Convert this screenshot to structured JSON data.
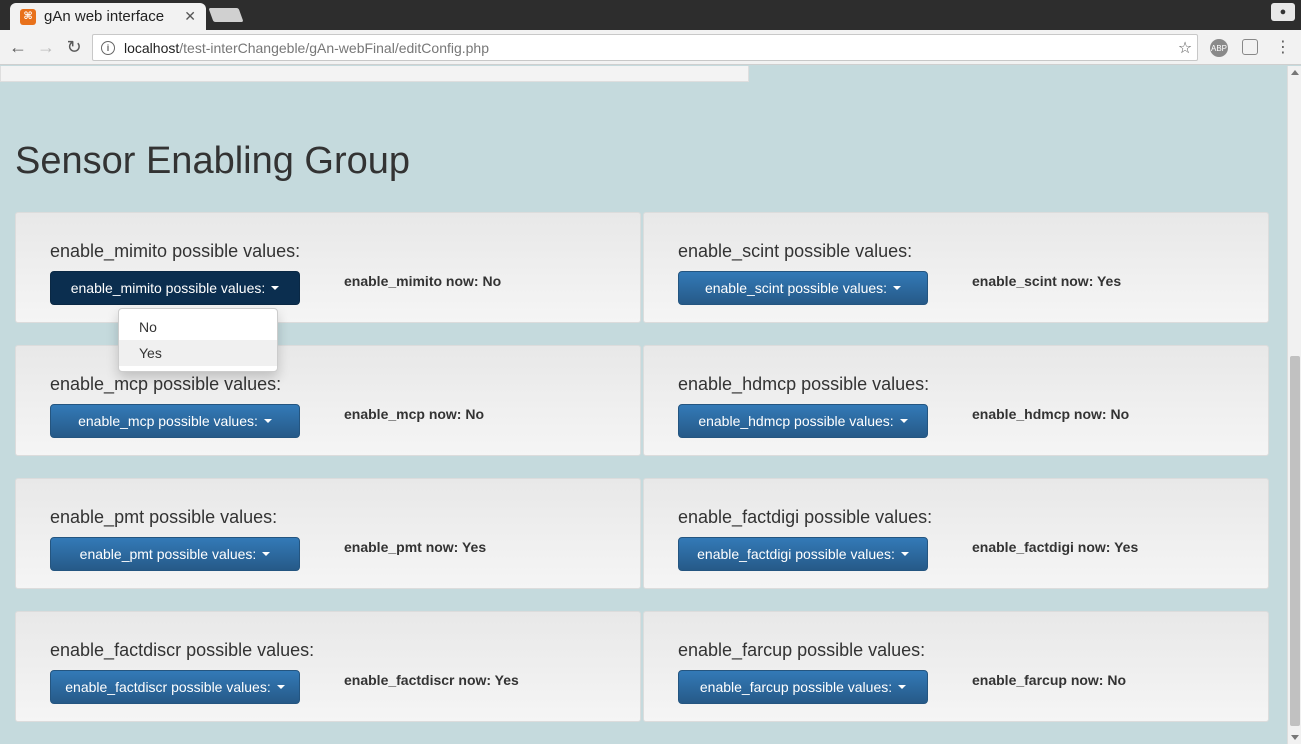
{
  "browser": {
    "tab_title": "gAn web interface",
    "tab_favicon_letter": "⌘",
    "close_glyph": "✕",
    "url_host": "localhost",
    "url_path": "/test-interChangeble/gAn-webFinal/editConfig.php",
    "ext_abp": "ABP"
  },
  "section_title": "Sensor Enabling Group",
  "cards": [
    {
      "label": "enable_mimito possible values:",
      "button": "enable_mimito possible values:",
      "now": "enable_mimito now: No"
    },
    {
      "label": "enable_scint possible values:",
      "button": "enable_scint possible values:",
      "now": "enable_scint now: Yes"
    },
    {
      "label": "enable_mcp possible values:",
      "button": "enable_mcp possible values:",
      "now": "enable_mcp now: No"
    },
    {
      "label": "enable_hdmcp possible values:",
      "button": "enable_hdmcp possible values:",
      "now": "enable_hdmcp now: No"
    },
    {
      "label": "enable_pmt possible values:",
      "button": "enable_pmt possible values:",
      "now": "enable_pmt now: Yes"
    },
    {
      "label": "enable_factdigi possible values:",
      "button": "enable_factdigi possible values:",
      "now": "enable_factdigi now: Yes"
    },
    {
      "label": "enable_factdiscr possible values:",
      "button": "enable_factdiscr possible values:",
      "now": "enable_factdiscr now: Yes"
    },
    {
      "label": "enable_farcup possible values:",
      "button": "enable_farcup possible values:",
      "now": "enable_farcup now: No"
    }
  ],
  "dropdown_menu": {
    "items": [
      "No",
      "Yes"
    ],
    "hovered": "Yes"
  },
  "colors": {
    "page_bg": "#c5dadd",
    "button_blue": "#337ab7",
    "button_open": "#0b2e4f"
  }
}
